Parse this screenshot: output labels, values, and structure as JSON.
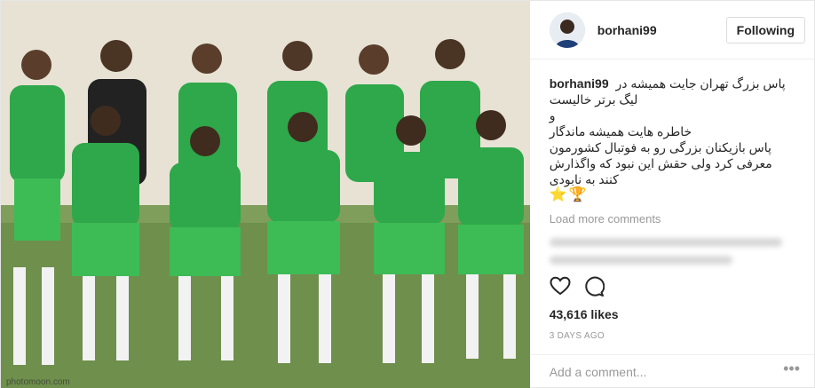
{
  "header": {
    "username": "borhani99",
    "follow_label": "Following"
  },
  "caption": {
    "username": "borhani99",
    "lines": [
      "پاس بزرگ تهران جایت همیشه در",
      "لیگ برتر خالیست",
      "و",
      "خاطره هایت همیشه ماندگار",
      "پاس بازیکنان بزرگی رو به فوتبال کشورمون",
      "معرفی کرد ولی حقش این نبود که واگذارش",
      "کنند به نابودی"
    ],
    "emoji": "⭐🏆"
  },
  "load_more": "Load more comments",
  "likes": "43,616 likes",
  "time": "3 DAYS AGO",
  "comment_placeholder": "Add a comment...",
  "more_label": "•••",
  "photo": {
    "watermark": "photomoon.com",
    "jersey_color": "#2ea84a",
    "shorts_color": "#3dbb55"
  }
}
